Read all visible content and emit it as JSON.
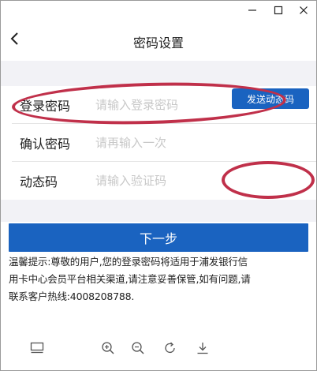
{
  "window": {
    "minimize_icon": "minimize-icon",
    "maximize_icon": "maximize-icon",
    "close_icon": "close-icon"
  },
  "header": {
    "back_icon": "chevron-left-icon",
    "title": "密码设置"
  },
  "form": {
    "login_password": {
      "label": "登录密码",
      "placeholder": "请输入登录密码",
      "value": ""
    },
    "confirm_password": {
      "label": "确认密码",
      "placeholder": "请再输入一次",
      "value": ""
    },
    "dynamic_code": {
      "label": "动态码",
      "placeholder": "请输入验证码",
      "value": ""
    },
    "send_code_label": "发送动态码"
  },
  "next_button_label": "下一步",
  "tip": "温馨提示:尊敬的用户,您的登录密码将适用于浦发银行信\n用卡中心会员平台相关渠道,请注意妥善保管,如有问题,请\n联系客户热线:4008208788.",
  "toolbar": {
    "icons": [
      "card-icon",
      "zoom-in-icon",
      "zoom-out-icon",
      "rotate-icon",
      "download-icon"
    ]
  },
  "colors": {
    "accent_blue": "#1a63c0",
    "annotation_red": "#c0304a",
    "page_gray": "#f2f2f6"
  }
}
